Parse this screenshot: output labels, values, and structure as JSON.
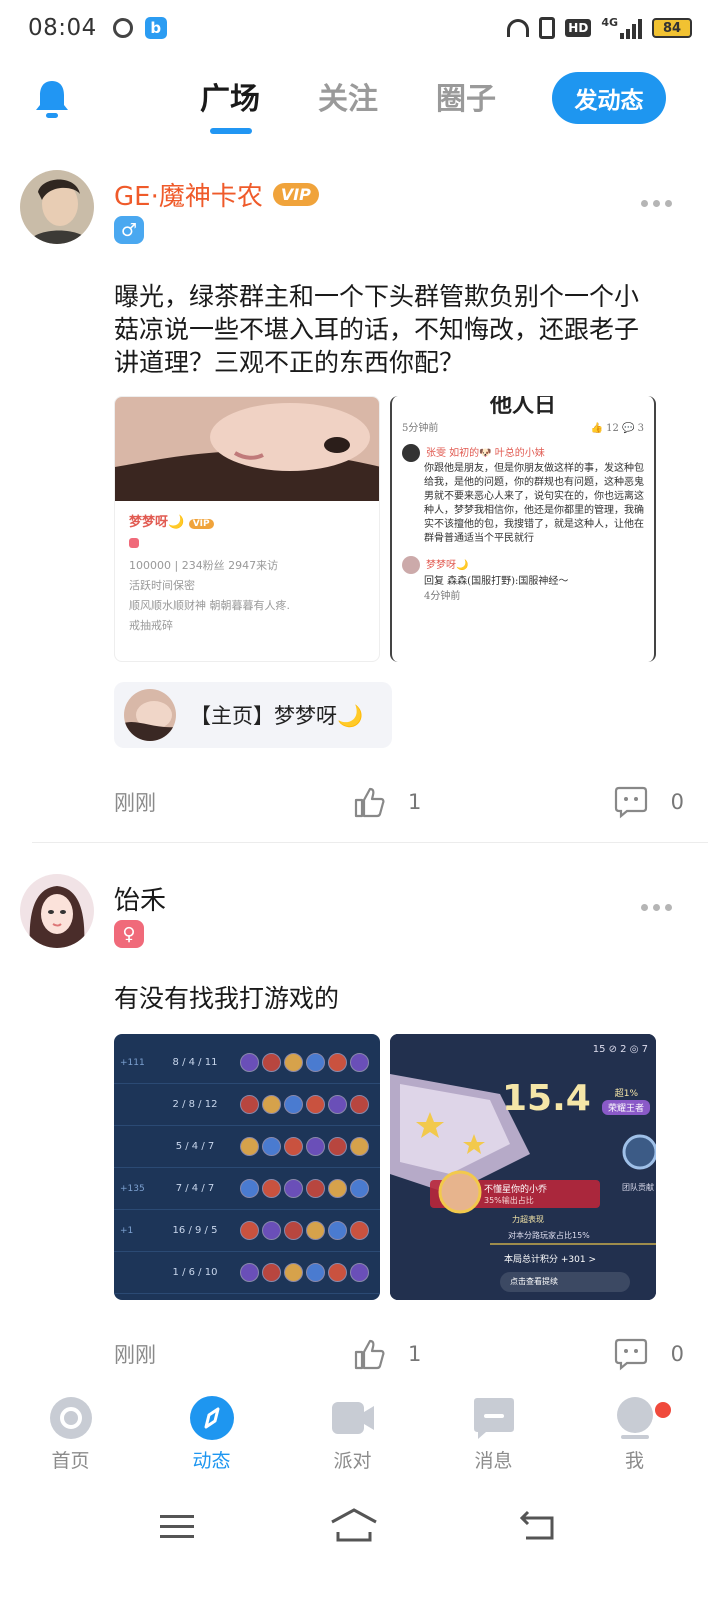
{
  "status_bar": {
    "time": "08:04",
    "network": "4G",
    "hd": "HD",
    "battery": "84"
  },
  "header": {
    "tabs": [
      {
        "label": "广场",
        "active": true
      },
      {
        "label": "关注",
        "active": false
      },
      {
        "label": "圈子",
        "active": false
      }
    ],
    "post_button": "发动态"
  },
  "posts": [
    {
      "username": "GE·魔神卡农",
      "username_color": "#ef5a2a",
      "vip": "VIP",
      "gender": "male",
      "gender_symbol": "♂",
      "gender_color": "#4aa8f0",
      "text": "曝光，绿茶群主和一个下头群管欺负别个一个小菇凉说一些不堪入耳的话，不知悔改，还跟老子讲道理？三观不正的东西你配？",
      "images": [
        {
          "name": "梦梦呀🌙",
          "stats": "100000 | 234粉丝 2947来访",
          "line1": "活跃时间保密",
          "line2": "顺风顺水顺财神  朝朝暮暮有人疼.",
          "line3": "戒抽戒碎"
        },
        {
          "top_text": "他人日",
          "time1": "5分钟前",
          "likes": "12",
          "comments": "3",
          "commenter": "张雯 如初的🐶 叶总的小妹",
          "comment_text": "你跟他是朋友，但是你朋友做这样的事，发这种包给我，是他的问题，你的群规也有问题，这种恶鬼男就不要来恶心人来了，说句实在的，你也远离这种人，梦梦我相信你，他还是你都里的管理，我确实不该擅他的包，我搜错了，就是这种人，让他在群骨普通适当个平民就行",
          "reply_user": "梦梦呀🌙",
          "reply_text": "回复 森森(国服打野):国服神经～",
          "time2": "4分钟前"
        }
      ],
      "link_card": "【主页】梦梦呀🌙",
      "time": "刚刚",
      "likes": "1",
      "comments": "0"
    },
    {
      "username": "饴禾",
      "username_color": "#1a1a1a",
      "gender": "female",
      "gender_symbol": "♀",
      "gender_color": "#f06a7a",
      "text": "有没有找我打游戏的",
      "images": [
        {
          "rows": [
            {
              "kda": "8 / 4 / 11",
              "gold": "+111"
            },
            {
              "kda": "2 / 8 / 12",
              "gold": ""
            },
            {
              "kda": "5 / 4 / 7",
              "gold": ""
            },
            {
              "kda": "7 / 4 / 7",
              "gold": "+135"
            },
            {
              "kda": "16 / 9 / 5",
              "gold": "+1"
            },
            {
              "kda": "1 / 6 / 10",
              "gold": ""
            }
          ]
        },
        {
          "score": "15.4",
          "header_stats": "15 ⊘ 2 ◎ 7",
          "badge": "荣耀王者",
          "pct": "超1%",
          "player": "不懂星你的小乔",
          "output": "35%输出占比",
          "side_label": "团队贡献",
          "label1": "力超表现",
          "stat_line": "对本分路玩家占比15%",
          "score_total": "本局总计积分 +301 >",
          "cta": "点击查看提续"
        }
      ],
      "time": "刚刚",
      "likes": "1",
      "comments": "0"
    }
  ],
  "bottom_nav": [
    {
      "label": "首页",
      "icon": "home-icon",
      "active": false
    },
    {
      "label": "动态",
      "icon": "compass-icon",
      "active": true
    },
    {
      "label": "派对",
      "icon": "video-icon",
      "active": false
    },
    {
      "label": "消息",
      "icon": "message-icon",
      "active": false
    },
    {
      "label": "我",
      "icon": "profile-icon",
      "active": false,
      "badge": true
    }
  ],
  "colors": {
    "accent": "#1e96f0",
    "vip": "#f0a33b",
    "badge": "#f04a3c"
  }
}
